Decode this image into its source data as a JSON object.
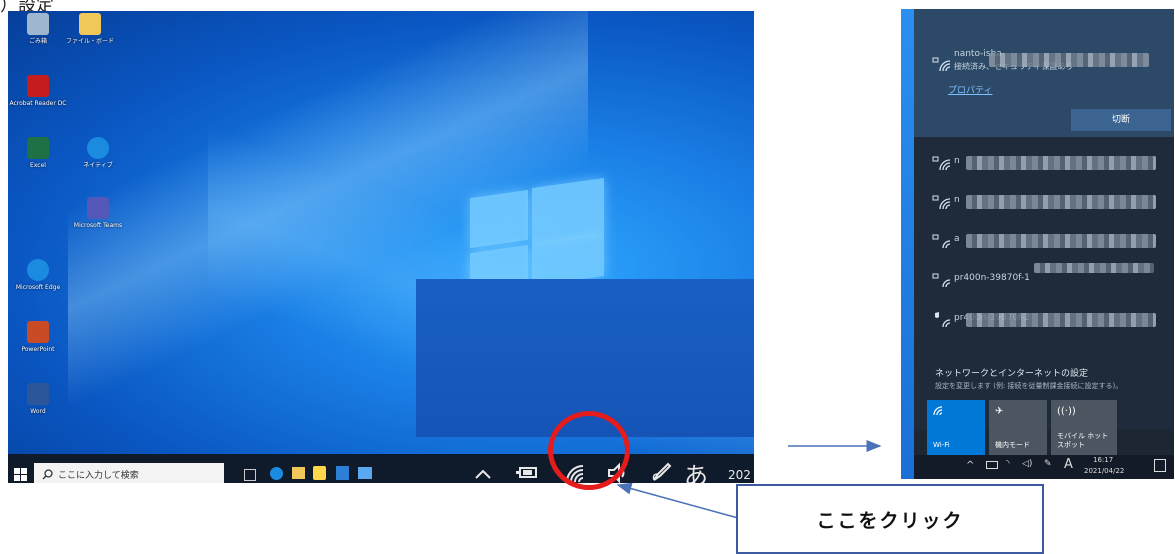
{
  "heading_fragment": "）設定",
  "desktop": {
    "icons": [
      {
        "label": "ごみ箱",
        "color": "#9fb6cf",
        "symbol": "🗑"
      },
      {
        "label": "ファイル・ボード",
        "color": "#f0c85a",
        "symbol": "📁"
      },
      {
        "label": "Acrobat Reader DC",
        "color": "#c51d1d",
        "symbol": "A"
      },
      {
        "label": "Excel",
        "color": "#1e7145",
        "symbol": "X"
      },
      {
        "label": "ネイティブ",
        "color": "#1b8be0",
        "symbol": "e"
      },
      {
        "label": "Microsoft Teams",
        "color": "#5458b8",
        "symbol": "T"
      },
      {
        "label": "Microsoft Edge",
        "color": "#1b8be0",
        "symbol": "e"
      },
      {
        "label": "PowerPoint",
        "color": "#c84b26",
        "symbol": "P"
      },
      {
        "label": "Word",
        "color": "#2b579a",
        "symbol": "W"
      }
    ],
    "taskbar": {
      "search_placeholder": "ここに入力して検索",
      "ime_char": "あ",
      "year_fragment": "202"
    }
  },
  "panel": {
    "networks": [
      {
        "name": "nanto-isha",
        "status": "接続済み、セキュリティ保護あり"
      },
      {
        "name": "n"
      },
      {
        "name": "n"
      },
      {
        "name": "a"
      },
      {
        "name": "pr400n-39870f-1"
      },
      {
        "name": "pr400n-39870f-2"
      }
    ],
    "properties_label": "プロパティ",
    "disconnect_label": "切断",
    "settings_title": "ネットワークとインターネットの設定",
    "settings_desc": "設定を変更します (例: 接続を従量制課金接続に設定する)。",
    "quick_actions": [
      {
        "label": "Wi-Fi",
        "icon": "wifi-icon",
        "active": true
      },
      {
        "label": "機内モード",
        "icon": "airplane-icon",
        "active": false
      },
      {
        "label": "モバイル ホットスポット",
        "icon": "hotspot-icon",
        "active": false
      }
    ],
    "ime_char": "A",
    "time": "16:17",
    "date": "2021/04/22"
  },
  "callout": {
    "text": "ここをクリック"
  },
  "colors": {
    "accent": "#0078d7",
    "annotation_red": "#e61b1b",
    "arrow_blue": "#4a72b8"
  }
}
